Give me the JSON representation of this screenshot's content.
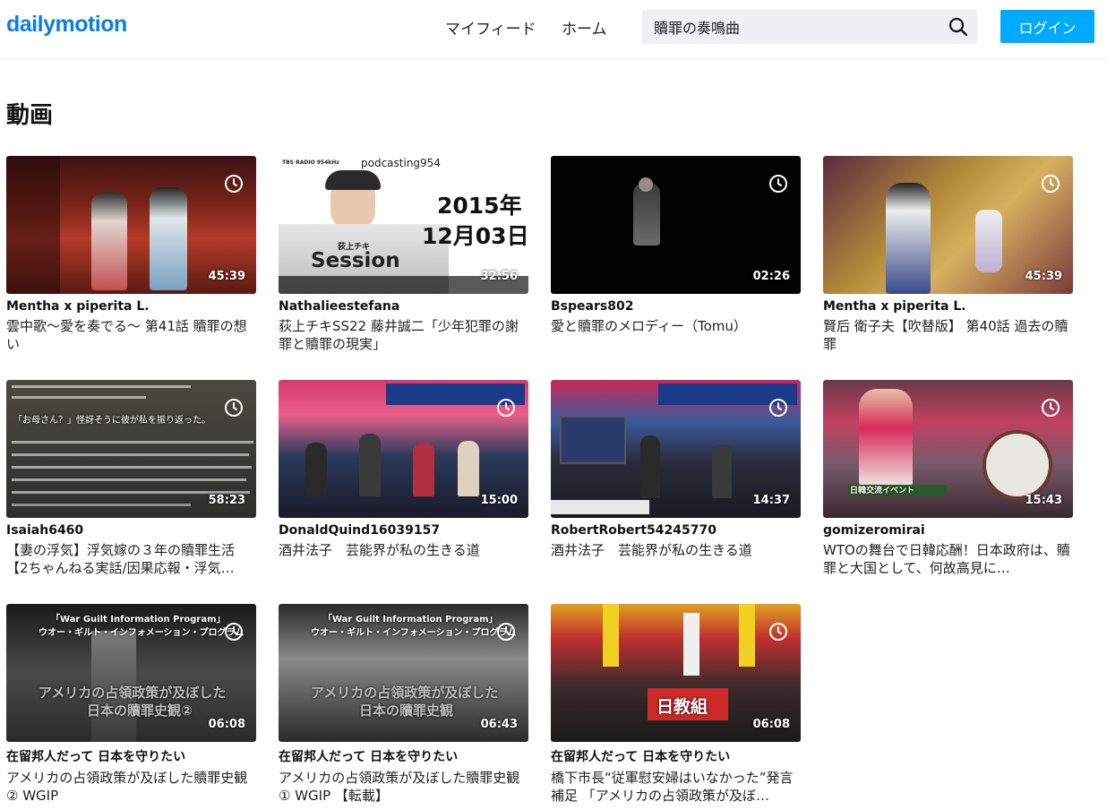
{
  "header": {
    "logo": "dailymotion",
    "nav": [
      "マイフィード",
      "ホーム"
    ],
    "search_value": "贖罪の奏鳴曲",
    "login_label": "ログイン",
    "accent_color": "#00aaff"
  },
  "section": {
    "title": "動画"
  },
  "videos": [
    {
      "channel": "Mentha x piperita L.",
      "title": "雲中歌～愛を奏でる～ 第41話 贖罪の想い",
      "duration": "45:39"
    },
    {
      "channel": "Nathalieestefana",
      "title": "荻上チキSS22 藤井誠二「少年犯罪の謝罪と贖罪の現実」",
      "duration": "32:56",
      "thumb_texts": [
        "TBS RADIO 954kHz",
        "podcasting954",
        "2015年",
        "12月03日",
        "荻上チキ",
        "Session"
      ]
    },
    {
      "channel": "Bspears802",
      "title": "愛と贖罪のメロディー（Tomu）",
      "duration": "02:26"
    },
    {
      "channel": "Mentha x piperita L.",
      "title": "賢后 衛子夫【吹替版】 第40話 過去の贖罪",
      "duration": "45:39"
    },
    {
      "channel": "Isaiah6460",
      "title": "【妻の浮気】浮気嫁の３年の贖罪生活【2ちゃんねる実話/因果応報・浮気…",
      "duration": "58:23",
      "thumb_texts": [
        "「お母さん？」怪訝そうに彼が私を振り返った。"
      ]
    },
    {
      "channel": "DonaldQuind16039157",
      "title": "酒井法子　芸能界が私の生きる道",
      "duration": "15:00"
    },
    {
      "channel": "RobertRobert54245770",
      "title": "酒井法子　芸能界が私の生きる道",
      "duration": "14:37"
    },
    {
      "channel": "gomizeromirai",
      "title": "WTOの舞台で日韓応酬！日本政府は、贖罪と大国として、何故高見に…",
      "duration": "15:43",
      "thumb_texts": [
        "日韓交流イベント"
      ]
    },
    {
      "channel": "在留邦人だって 日本を守りたい",
      "title": "アメリカの占領政策が及ぼした贖罪史観② WGIP",
      "duration": "06:08",
      "thumb_texts": [
        "「War Guilt Information Program」",
        "ウオー・ギルト・インフォメーション・プログラム",
        "アメリカの占領政策が及ぼした",
        "日本の贖罪史観②"
      ]
    },
    {
      "channel": "在留邦人だって 日本を守りたい",
      "title": "アメリカの占領政策が及ぼした贖罪史観① WGIP 【転載】",
      "duration": "06:43",
      "thumb_texts": [
        "「War Guilt Information Program」",
        "ウオー・ギルト・インフォメーション・プログラム",
        "アメリカの占領政策が及ぼした",
        "日本の贖罪史観"
      ]
    },
    {
      "channel": "在留邦人だって 日本を守りたい",
      "title": "橋下市長“従軍慰安婦はいなかった”発言補足 「アメリカの占領政策が及ぼ…",
      "duration": "06:08",
      "thumb_texts": [
        "日教組"
      ]
    }
  ]
}
